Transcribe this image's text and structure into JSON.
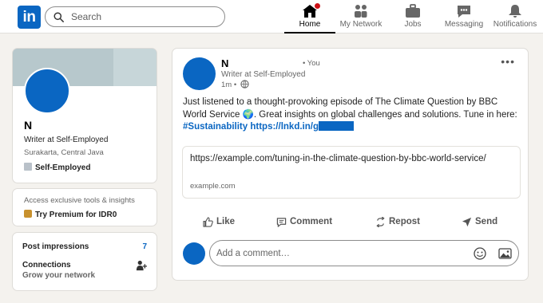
{
  "nav": {
    "logo": "in",
    "search_placeholder": "Search",
    "items": [
      {
        "label": "Home",
        "icon": "home-icon",
        "active": true
      },
      {
        "label": "My Network",
        "icon": "network-icon"
      },
      {
        "label": "Jobs",
        "icon": "jobs-icon"
      },
      {
        "label": "Messaging",
        "icon": "messaging-icon"
      },
      {
        "label": "Notifications",
        "icon": "notifications-icon"
      }
    ]
  },
  "profile": {
    "name": "N",
    "headline": "Writer at Self-Employed",
    "location": "Surakarta, Central Java",
    "company": "Self-Employed"
  },
  "premium": {
    "teaser": "Access exclusive tools & insights",
    "cta": "Try Premium for IDR0"
  },
  "stats": {
    "impressions_label": "Post impressions",
    "impressions_value": "7",
    "connections_label": "Connections",
    "connections_sub": "Grow your network"
  },
  "post": {
    "author": "N",
    "you": "• You",
    "headline": "Writer at Self-Employed",
    "time": "1m •",
    "text": "Just listened to a thought-provoking episode of The Climate Question by BBC World Service 🌍. Great insights on global challenges and solutions. Tune in here: ",
    "hashtag": "#Sustainability",
    "link_short": "https://lnkd.in/g",
    "preview_url": "https://example.com/tuning-in-the-climate-question-by-bbc-world-service/",
    "preview_domain": "example.com",
    "more": "•••"
  },
  "actions": {
    "like": "Like",
    "comment": "Comment",
    "repost": "Repost",
    "send": "Send"
  },
  "comment": {
    "placeholder": "Add a comment…"
  },
  "colors": {
    "brand": "#0a66c2",
    "notification_dot": "#cc1016",
    "background": "#f4f2ee"
  }
}
